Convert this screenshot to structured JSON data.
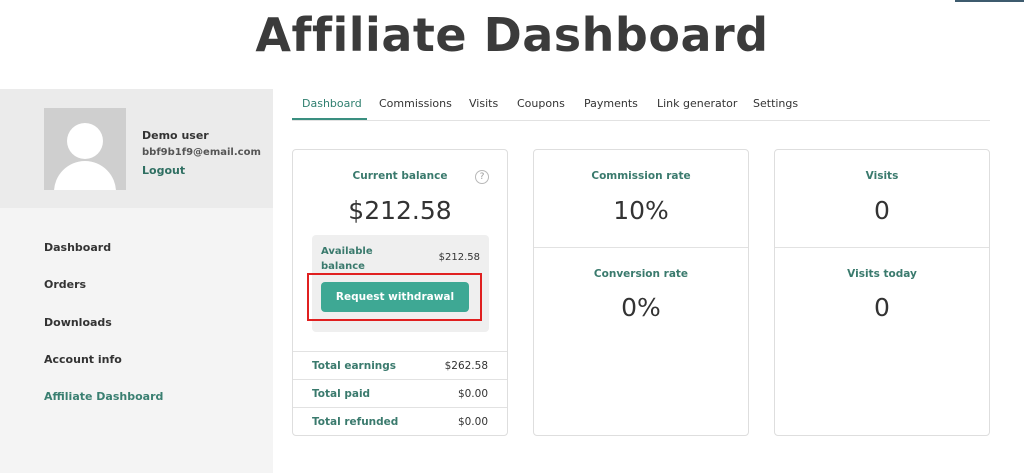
{
  "page_title": "Affiliate Dashboard",
  "user": {
    "name": "Demo user",
    "email": "bbf9b1f9@email.com",
    "logout_label": "Logout"
  },
  "sidebar": {
    "items": [
      {
        "label": "Dashboard"
      },
      {
        "label": "Orders"
      },
      {
        "label": "Downloads"
      },
      {
        "label": "Account info"
      },
      {
        "label": "Affiliate Dashboard",
        "active": true
      }
    ]
  },
  "tabs": [
    {
      "label": "Dashboard",
      "active": true
    },
    {
      "label": "Commissions"
    },
    {
      "label": "Visits"
    },
    {
      "label": "Coupons"
    },
    {
      "label": "Payments"
    },
    {
      "label": "Link generator"
    },
    {
      "label": "Settings"
    }
  ],
  "balance_card": {
    "label": "Current balance",
    "help_icon": "question-circle-icon",
    "value": "$212.58",
    "available_label": "Available balance",
    "available_value": "$212.58",
    "withdraw_button": "Request withdrawal",
    "summary": [
      {
        "label": "Total earnings",
        "value": "$262.58"
      },
      {
        "label": "Total paid",
        "value": "$0.00"
      },
      {
        "label": "Total refunded",
        "value": "$0.00"
      }
    ]
  },
  "rate_card": {
    "commission_label": "Commission rate",
    "commission_value": "10%",
    "conversion_label": "Conversion rate",
    "conversion_value": "0%"
  },
  "visits_card": {
    "visits_label": "Visits",
    "visits_value": "0",
    "today_label": "Visits today",
    "today_value": "0"
  },
  "colors": {
    "accent": "#3ea894",
    "label_teal": "#3a7a6d",
    "highlight": "#e02020"
  }
}
